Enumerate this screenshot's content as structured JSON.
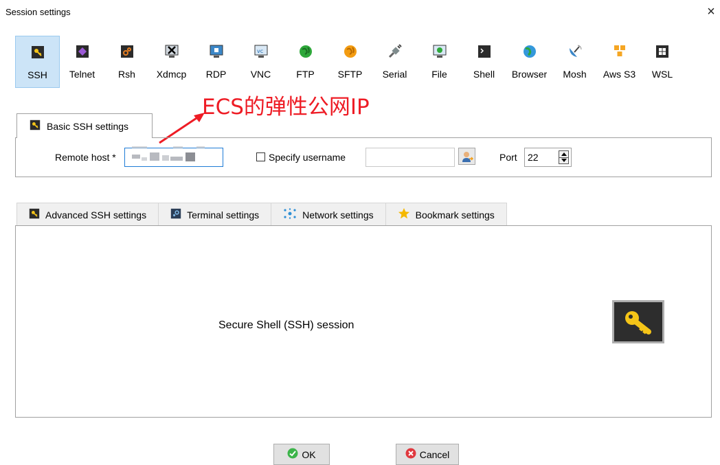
{
  "window": {
    "title": "Session settings",
    "close_glyph": "×"
  },
  "session_types": [
    {
      "label": "SSH",
      "icon": "ssh-key-icon",
      "selected": true
    },
    {
      "label": "Telnet",
      "icon": "telnet-icon"
    },
    {
      "label": "Rsh",
      "icon": "rsh-icon"
    },
    {
      "label": "Xdmcp",
      "icon": "xdmcp-icon"
    },
    {
      "label": "RDP",
      "icon": "rdp-icon"
    },
    {
      "label": "VNC",
      "icon": "vnc-icon"
    },
    {
      "label": "FTP",
      "icon": "ftp-globe-icon"
    },
    {
      "label": "SFTP",
      "icon": "sftp-globe-icon"
    },
    {
      "label": "Serial",
      "icon": "serial-plug-icon"
    },
    {
      "label": "File",
      "icon": "file-monitor-icon"
    },
    {
      "label": "Shell",
      "icon": "shell-terminal-icon"
    },
    {
      "label": "Browser",
      "icon": "browser-globe-icon"
    },
    {
      "label": "Mosh",
      "icon": "mosh-satellite-icon"
    },
    {
      "label": "Aws S3",
      "icon": "aws-cubes-icon"
    },
    {
      "label": "WSL",
      "icon": "windows-icon"
    }
  ],
  "annotation": {
    "text": "ECS的弹性公网IP",
    "color": "#ee1c25"
  },
  "basic_settings": {
    "tab_label": "Basic SSH settings",
    "remote_host_label": "Remote host *",
    "remote_host_value": "",
    "specify_username_label": "Specify username",
    "specify_username_checked": false,
    "username_value": "",
    "port_label": "Port",
    "port_value": "22"
  },
  "tabs": [
    {
      "label": "Advanced SSH settings",
      "icon": "ssh-key-icon"
    },
    {
      "label": "Terminal settings",
      "icon": "terminal-icon"
    },
    {
      "label": "Network settings",
      "icon": "network-icon"
    },
    {
      "label": "Bookmark settings",
      "icon": "star-icon"
    }
  ],
  "panel": {
    "description": "Secure Shell (SSH) session",
    "icon": "large-key-icon"
  },
  "buttons": {
    "ok": "OK",
    "cancel": "Cancel"
  },
  "colors": {
    "selection": "#cce4f7",
    "annotation": "#ee1c25",
    "focus_border": "#1e7bd6"
  }
}
